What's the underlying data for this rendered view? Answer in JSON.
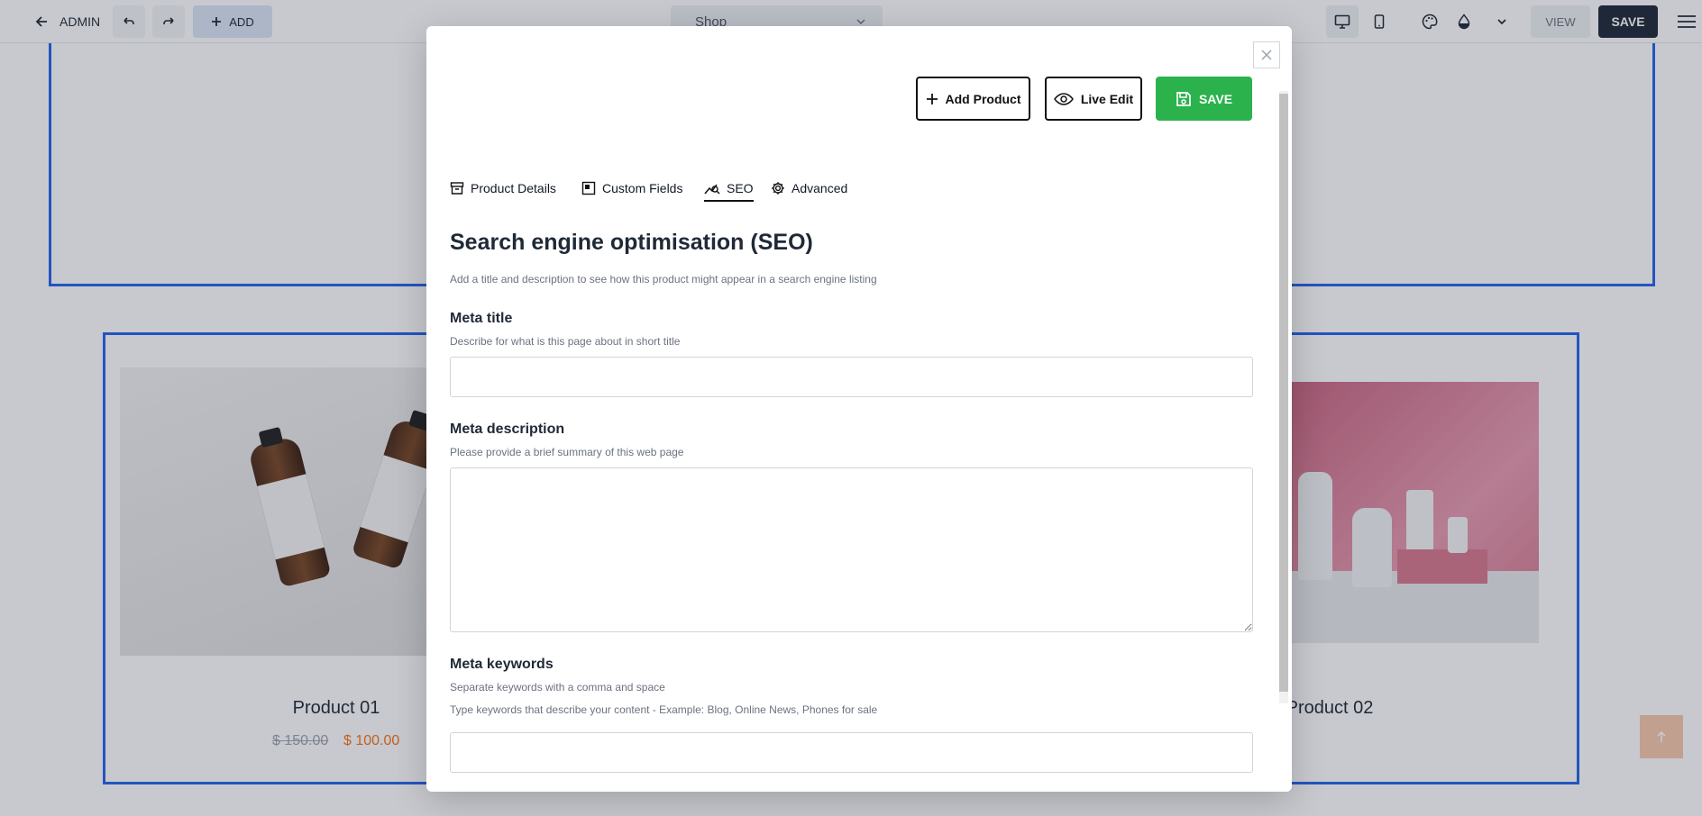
{
  "toolbar": {
    "admin_label": "ADMIN",
    "add_label": "ADD",
    "page_select": "Shop",
    "view_label": "VIEW",
    "save_label": "SAVE"
  },
  "products": [
    {
      "name": "Product 01",
      "old_price": "$ 150.00",
      "new_price": "$ 100.00"
    },
    {
      "name": "Product 02"
    }
  ],
  "modal": {
    "add_product_label": "Add Product",
    "live_edit_label": "Live Edit",
    "save_label": "SAVE",
    "tabs": [
      {
        "label": "Product Details",
        "icon": "archive-icon"
      },
      {
        "label": "Custom Fields",
        "icon": "custom-fields-icon"
      },
      {
        "label": "SEO",
        "icon": "seo-chart-icon",
        "active": true
      },
      {
        "label": "Advanced",
        "icon": "gear-icon"
      }
    ],
    "heading": "Search engine optimisation (SEO)",
    "subheading": "Add a title and description to see how this product might appear in a search engine listing",
    "meta_title": {
      "label": "Meta title",
      "help": "Describe for what is this page about in short title",
      "value": ""
    },
    "meta_description": {
      "label": "Meta description",
      "help": "Please provide a brief summary of this web page",
      "value": ""
    },
    "meta_keywords": {
      "label": "Meta keywords",
      "help": "Separate keywords with a comma and space",
      "help2": "Type keywords that describe your content - Example: Blog, Online News, Phones for sale",
      "value": ""
    }
  },
  "colors": {
    "accent": "#2563eb",
    "save_green": "#2bb24c",
    "dark": "#1f2937",
    "price_sale": "#f97316"
  }
}
